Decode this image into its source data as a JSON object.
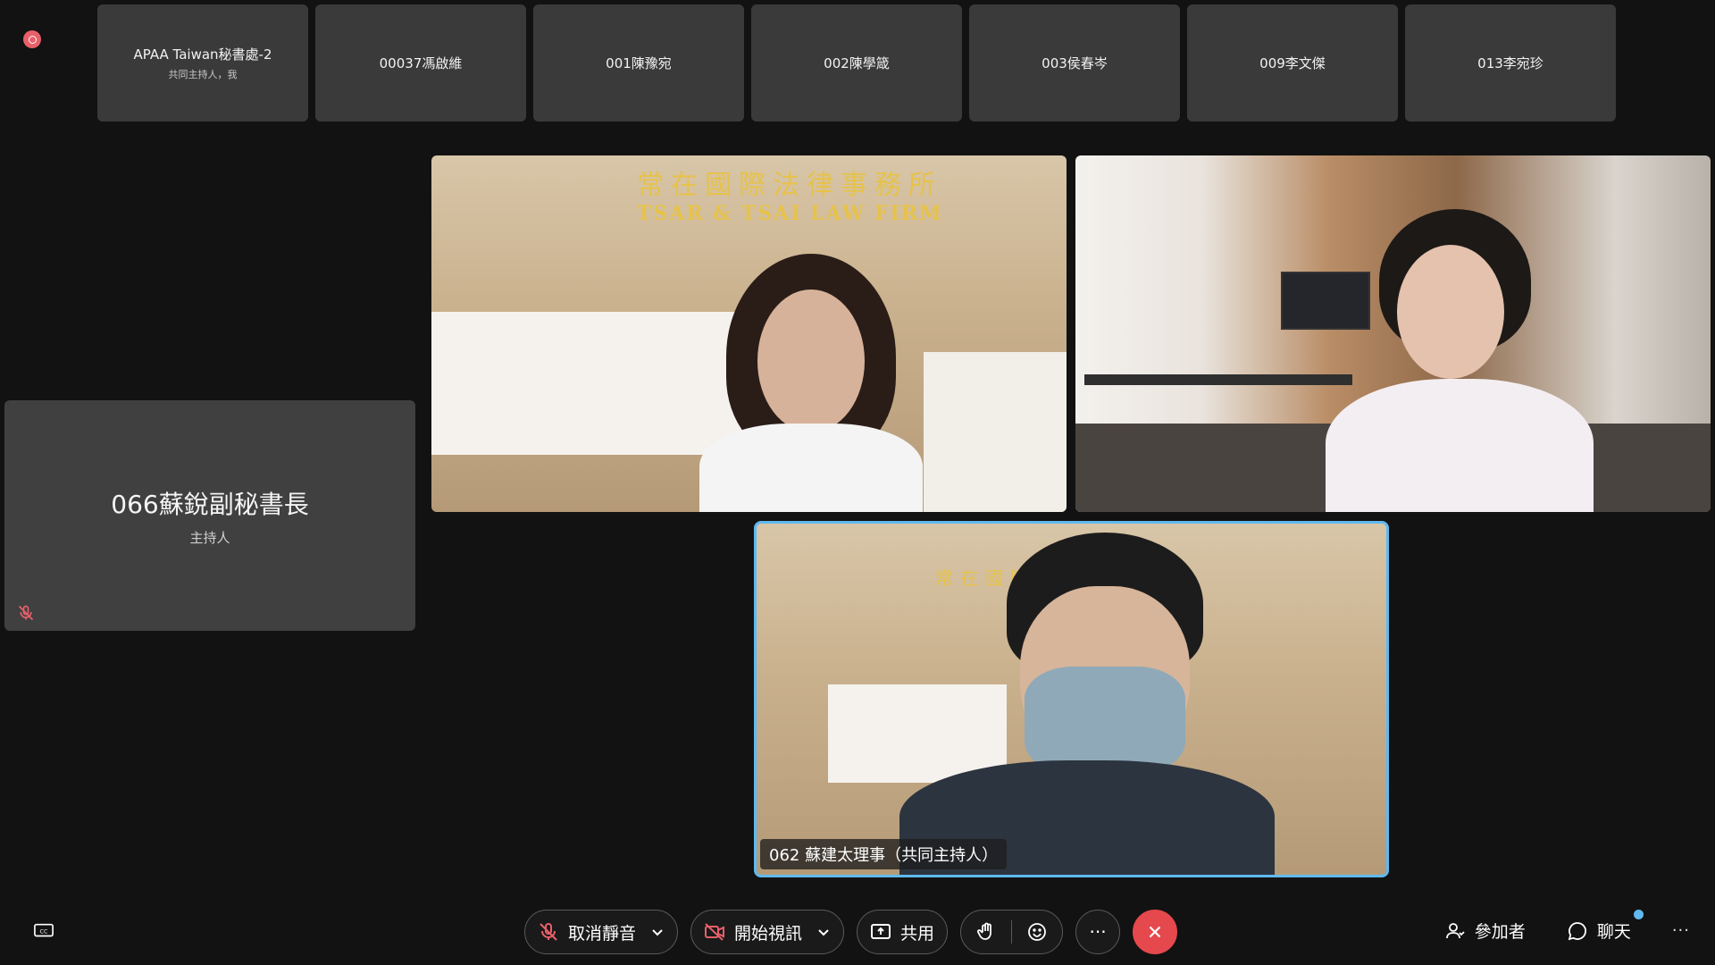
{
  "participants_strip": [
    {
      "name": "APAA Taiwan秘書處-2",
      "subtitle": "共同主持人，我"
    },
    {
      "name": "00037馮啟維",
      "subtitle": ""
    },
    {
      "name": "001陳豫宛",
      "subtitle": ""
    },
    {
      "name": "002陳學箴",
      "subtitle": ""
    },
    {
      "name": "003侯春岑",
      "subtitle": ""
    },
    {
      "name": "009李文傑",
      "subtitle": ""
    },
    {
      "name": "013李宛珍",
      "subtitle": ""
    }
  ],
  "host_tile": {
    "name": "066蘇銳副秘書長",
    "role": "主持人"
  },
  "video_sign": {
    "cn": "常在國際法律事務所",
    "en": "TSAR & TSAI LAW FIRM"
  },
  "active_speaker": {
    "caption": "062 蘇建太理事（共同主持人）"
  },
  "controls": {
    "unmute_label": "取消靜音",
    "start_video_label": "開始視訊",
    "share_label": "共用",
    "more_label": "···",
    "participants_label": "參加者",
    "chat_label": "聊天",
    "overflow_label": "···"
  },
  "colors": {
    "background": "#121212",
    "tile": "#3a3a3a",
    "active_border": "#5fb9f0",
    "end_call": "#e5484d",
    "record": "#e8606a"
  }
}
